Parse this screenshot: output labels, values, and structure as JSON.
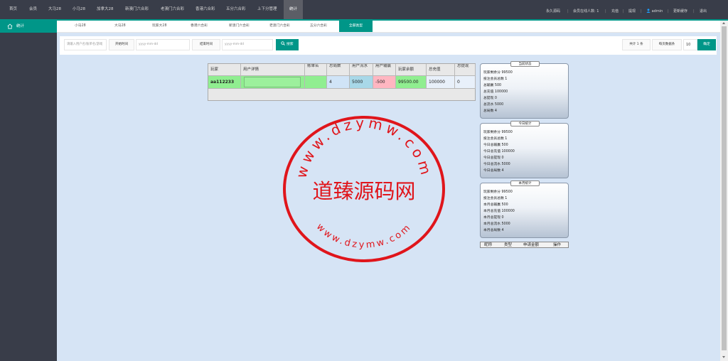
{
  "topnav": {
    "items": [
      "首页",
      "会员",
      "大马28",
      "小马28",
      "加拿大28",
      "新澳门六合彩",
      "老澳门六合彩",
      "香港六合彩",
      "五分六合彩",
      "上下分管理",
      "统计"
    ],
    "active_index": 10,
    "right_label_permanent": "永久源码",
    "right_online": "会员在线人数: 1",
    "right_recharge": "充值",
    "right_withdraw": "提现",
    "right_user": "admin",
    "right_clear_cache": "更新缓存",
    "right_logout": "退出"
  },
  "sidebar": {
    "item_label": "统计",
    "icon": "home-icon"
  },
  "subtabs": {
    "items": [
      "小马28",
      "大马28",
      "玩家大28",
      "香港六合彩",
      "新澳门六合彩",
      "老澳门六合彩",
      "五分六合彩",
      "全部类型"
    ],
    "active_index": 7
  },
  "filter": {
    "user_placeholder": "请输入用户名/账单名/游戏",
    "start_label": "开始时间",
    "start_placeholder": "yyyy-mm-dd",
    "end_label": "结束时间",
    "end_placeholder": "yyyy-mm-dd",
    "search_label": "搜索",
    "total_label": "共计 1 条",
    "per_page_label": "每页数据条",
    "per_page_value": "10",
    "confirm_label": "确定"
  },
  "table": {
    "headers": [
      "玩家",
      "用户详情",
      "账单名",
      "总局数",
      "用户流水",
      "用户输赢",
      "玩家余额",
      "总充值",
      "总提现"
    ],
    "row": [
      "aa112233",
      "",
      "",
      "4",
      "5000",
      "-500",
      "99500.00",
      "100000",
      "0"
    ]
  },
  "panels": [
    {
      "title": "当前状态",
      "rows": [
        "玩家剩余分 99500",
        "投注会员总数 1",
        "总输赢 500",
        "总充值 100000",
        "总提现 0",
        "总流水 5000",
        "总局数 4"
      ]
    },
    {
      "title": "今日统计",
      "rows": [
        "玩家剩余分 99500",
        "投注会员总数 1",
        "今日总输赢 500",
        "今日总充值 100000",
        "今日总提现 0",
        "今日总流水 5000",
        "今日总局数 4"
      ]
    },
    {
      "title": "本月统计",
      "rows": [
        "玩家剩余分 99500",
        "投注会员总数 1",
        "本月总输赢 500",
        "本月总充值 100000",
        "本月总提现 0",
        "本月总流水 5000",
        "本月总局数 4"
      ]
    }
  ],
  "bottom_headers": [
    "昵称",
    "类型",
    "申请金额",
    "操作"
  ],
  "watermark": {
    "text": "道臻源码网",
    "ring_top": "www.dzymw.com",
    "ring_bottom": "www.dzymw.com",
    "color": "#e0151b"
  },
  "colors": {
    "accent": "#009688",
    "nav_bg": "#393d49",
    "page_bg": "#d6e4f5"
  }
}
